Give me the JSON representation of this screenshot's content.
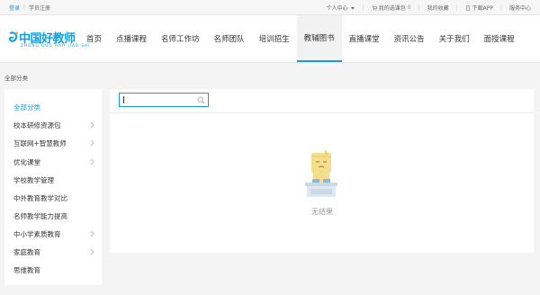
{
  "topbar": {
    "login": "登录",
    "register": "学员注册",
    "personal_center": "个人中心",
    "cart_label": "我的选课包",
    "cart_count": "0",
    "favorites": "我的收藏",
    "download_app": "下载APP",
    "service_center": "服务中心"
  },
  "logo": {
    "name": "中国好教师",
    "pinyin": "ZHONG GUO HAO JIAO SHI"
  },
  "nav": {
    "items": [
      {
        "label": "首页"
      },
      {
        "label": "点播课程"
      },
      {
        "label": "名师工作坊"
      },
      {
        "label": "名师团队"
      },
      {
        "label": "培训招生"
      },
      {
        "label": "教辅图书",
        "active": true
      },
      {
        "label": "直播课堂"
      },
      {
        "label": "资讯公告"
      },
      {
        "label": "关于我们"
      },
      {
        "label": "面授课程"
      }
    ]
  },
  "breadcrumb": "全部分类",
  "sidebar": {
    "items": [
      {
        "label": "全部分类",
        "active": true,
        "has_children": false
      },
      {
        "label": "校本研修资源包",
        "has_children": true
      },
      {
        "label": "互联网+智慧教师",
        "has_children": true
      },
      {
        "label": "优化课堂",
        "has_children": true
      },
      {
        "label": "学校教学管理",
        "has_children": false
      },
      {
        "label": "中外教育教学对比",
        "has_children": false
      },
      {
        "label": "名师教学能力提高",
        "has_children": false
      },
      {
        "label": "中小学素质教育",
        "has_children": true
      },
      {
        "label": "家庭教育",
        "has_children": true
      },
      {
        "label": "思维教育",
        "has_children": false
      }
    ]
  },
  "search": {
    "value": "",
    "placeholder": ""
  },
  "empty_state": {
    "text": "无结果"
  },
  "colors": {
    "accent": "#1a9ad6",
    "logo": "#0aa0e0",
    "badge": "#f07b00",
    "background": "#f4f4f4"
  }
}
